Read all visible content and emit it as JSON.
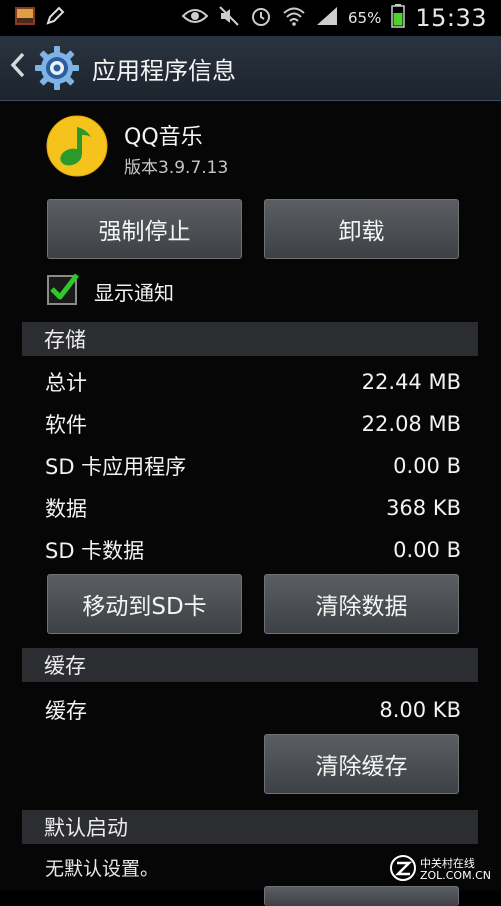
{
  "status_bar": {
    "battery_percent": "65%",
    "time": "15:33",
    "icons": [
      "photo-thumbnail-icon",
      "pen-icon",
      "eye-icon",
      "mute-icon",
      "alarm-icon",
      "wifi-icon",
      "signal-icon",
      "battery-icon"
    ],
    "battery_color": "#4fd12b"
  },
  "action_bar": {
    "title": "应用程序信息"
  },
  "app": {
    "name": "QQ音乐",
    "version": "版本3.9.7.13",
    "icon": "qq-music-icon"
  },
  "buttons": {
    "force_stop": "强制停止",
    "uninstall": "卸载",
    "move_to_sd": "移动到SD卡",
    "clear_data": "清除数据",
    "clear_cache": "清除缓存"
  },
  "notification": {
    "label": "显示通知",
    "checked": true
  },
  "storage": {
    "header": "存储",
    "rows": [
      {
        "label": "总计",
        "value": "22.44 MB"
      },
      {
        "label": "软件",
        "value": "22.08 MB"
      },
      {
        "label": "SD 卡应用程序",
        "value": "0.00 B"
      },
      {
        "label": "数据",
        "value": "368 KB"
      },
      {
        "label": "SD 卡数据",
        "value": "0.00 B"
      }
    ]
  },
  "cache": {
    "header": "缓存",
    "label": "缓存",
    "value": "8.00 KB"
  },
  "default_launch": {
    "header": "默认启动",
    "note": "无默认设置。"
  },
  "watermark": {
    "line1": "中关村在线",
    "line2": "ZOL.COM.CN"
  },
  "colors": {
    "accent_check": "#2ec82e",
    "action_bar": "#222b35"
  }
}
